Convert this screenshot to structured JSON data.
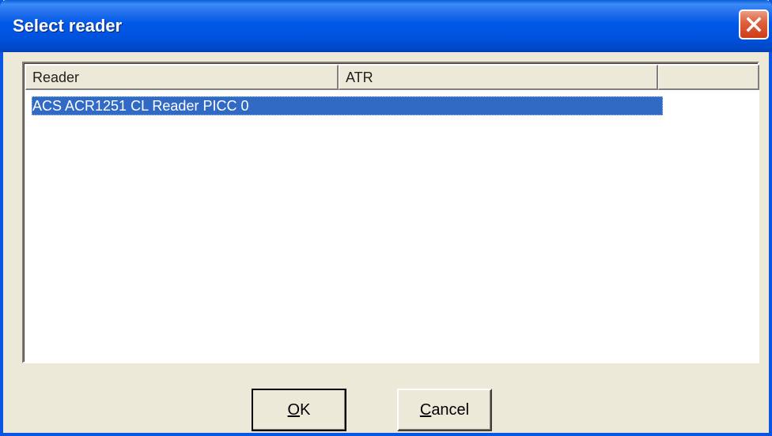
{
  "window": {
    "title": "Select reader"
  },
  "list": {
    "columns": [
      "Reader",
      "ATR",
      ""
    ],
    "rows": [
      {
        "reader": "ACS ACR1251 CL Reader PICC 0",
        "atr": "",
        "selected": true
      }
    ]
  },
  "buttons": {
    "ok_label": "OK",
    "cancel_label": "Cancel"
  },
  "icons": {
    "close": "close-icon"
  },
  "colors": {
    "titlebar": "#0058e6",
    "selection": "#316ac5",
    "close": "#e1613e",
    "face": "#ece9d8"
  }
}
